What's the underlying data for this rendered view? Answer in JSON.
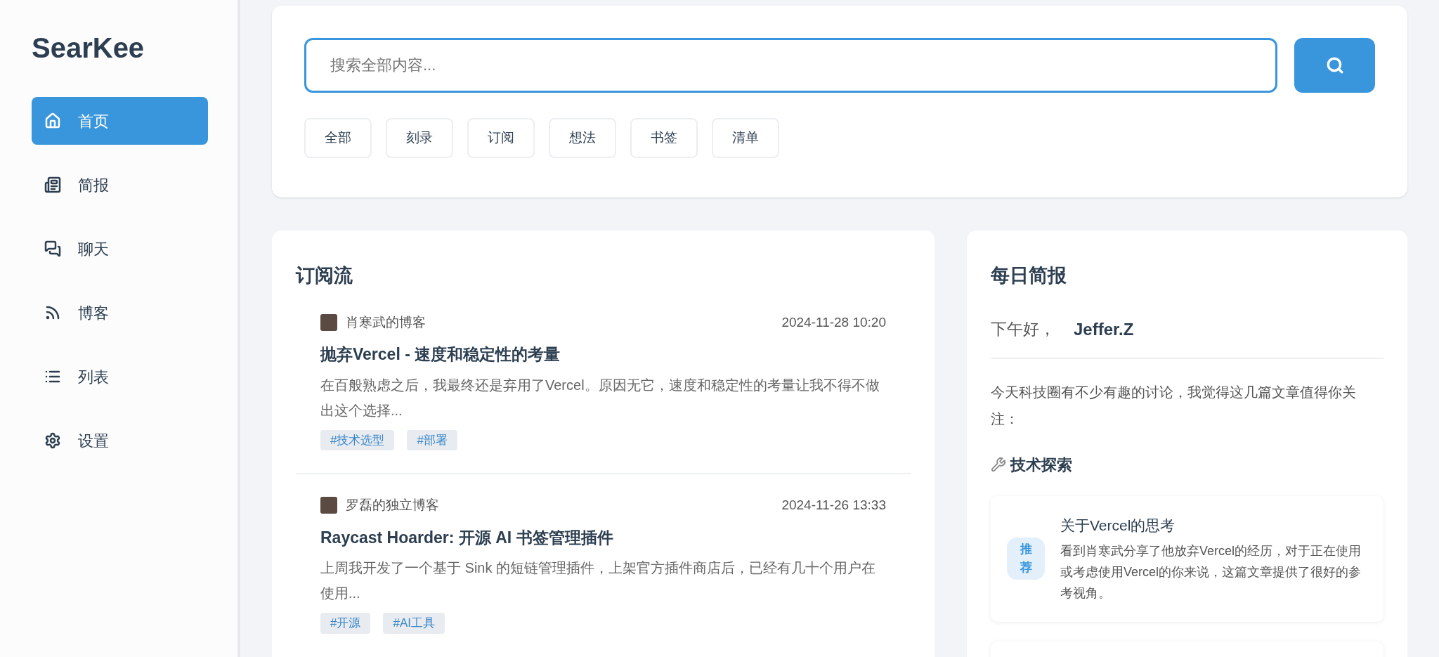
{
  "sidebar": {
    "logo": "SearKee",
    "items": [
      {
        "kind": "home",
        "label": "首页",
        "selected": true
      },
      {
        "kind": "brief",
        "label": "简报",
        "selected": false
      },
      {
        "kind": "chat",
        "label": "聊天",
        "selected": false
      },
      {
        "kind": "blog",
        "label": "博客",
        "selected": false
      },
      {
        "kind": "list",
        "label": "列表",
        "selected": false
      },
      {
        "kind": "settings",
        "label": "设置",
        "selected": false
      }
    ]
  },
  "search": {
    "placeholder": "搜索全部内容...",
    "filters": [
      "全部",
      "刻录",
      "订阅",
      "想法",
      "书签",
      "清单"
    ]
  },
  "feed": {
    "title": "订阅流",
    "items": [
      {
        "source": "肖寒武的博客",
        "time": "2024-11-28 10:20",
        "title": "抛弃Vercel - 速度和稳定性的考量",
        "summary": "在百般熟虑之后，我最终还是弃用了Vercel。原因无它，速度和稳定性的考量让我不得不做出这个选择...",
        "tags": [
          "#技术选型",
          "#部署"
        ]
      },
      {
        "source": "罗磊的独立博客",
        "time": "2024-11-26 13:33",
        "title": "Raycast Hoarder: 开源 AI 书签管理插件",
        "summary": "上周我开发了一个基于 Sink 的短链管理插件，上架官方插件商店后，已经有几十个用户在使用...",
        "tags": [
          "#开源",
          "#AI工具"
        ]
      }
    ]
  },
  "brief": {
    "title": "每日简报",
    "greeting": "下午好，",
    "name": "Jeffer.Z",
    "intro": "今天科技圈有不少有趣的讨论，我觉得这几篇文章值得你关注：",
    "section": "技术探索",
    "cards": [
      {
        "badge": "推荐",
        "title": "关于Vercel的思考",
        "text": "看到肖寒武分享了他放弃Vercel的经历，对于正在使用或考虑使用Vercel的你来说，这篇文章提供了很好的参考视角。"
      }
    ]
  }
}
